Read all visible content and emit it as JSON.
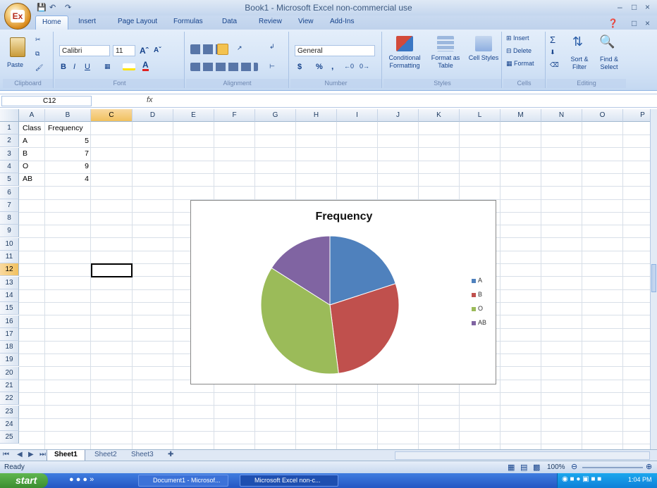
{
  "window": {
    "title": "Book1 - Microsoft Excel non-commercial use",
    "office_button": "Ex"
  },
  "tabs": [
    "Home",
    "Insert",
    "Page Layout",
    "Formulas",
    "Data",
    "Review",
    "View",
    "Add-Ins"
  ],
  "ribbon": {
    "clipboard": {
      "label": "Clipboard",
      "paste": "Paste"
    },
    "font": {
      "label": "Font",
      "name": "Calibri",
      "size": "11",
      "bold": "B",
      "italic": "I",
      "underline": "U"
    },
    "alignment": {
      "label": "Alignment"
    },
    "number": {
      "label": "Number",
      "format": "General",
      "currency": "$",
      "percent": "%",
      "comma": ","
    },
    "styles": {
      "label": "Styles",
      "conditional": "Conditional Formatting",
      "format_table": "Format as Table",
      "cell_styles": "Cell Styles"
    },
    "cells": {
      "label": "Cells",
      "insert": "Insert",
      "delete": "Delete",
      "format": "Format"
    },
    "editing": {
      "label": "Editing",
      "sort": "Sort & Filter",
      "find": "Find & Select",
      "sum": "Σ"
    }
  },
  "formula_bar": {
    "name_box": "C12",
    "fx": "fx",
    "value": ""
  },
  "columns": [
    "A",
    "B",
    "C",
    "D",
    "E",
    "F",
    "G",
    "H",
    "I",
    "J",
    "K",
    "L",
    "M",
    "N",
    "O",
    "P"
  ],
  "rows": [
    "1",
    "2",
    "3",
    "4",
    "5",
    "6",
    "7",
    "8",
    "9",
    "10",
    "11",
    "12",
    "13",
    "14",
    "15",
    "16",
    "17",
    "18",
    "19",
    "20",
    "21",
    "22",
    "23",
    "24",
    "25"
  ],
  "table": {
    "headers": [
      "Class",
      "Frequency"
    ],
    "rows": [
      [
        "A",
        "5"
      ],
      [
        "B",
        "7"
      ],
      [
        "O",
        "9"
      ],
      [
        "AB",
        "4"
      ]
    ]
  },
  "chart_data": {
    "type": "pie",
    "title": "Frequency",
    "categories": [
      "A",
      "B",
      "O",
      "AB"
    ],
    "values": [
      5,
      7,
      9,
      4
    ],
    "colors": [
      "#4f81bd",
      "#c0504d",
      "#9bbb59",
      "#8064a2"
    ],
    "legend": "right"
  },
  "sheets": [
    "Sheet1",
    "Sheet2",
    "Sheet3"
  ],
  "status": {
    "ready": "Ready",
    "zoom": "100%"
  },
  "taskbar": {
    "start": "start",
    "items": [
      "Document1 - Microsof...",
      "Microsoft Excel non-c..."
    ],
    "clock": "1:04 PM"
  }
}
